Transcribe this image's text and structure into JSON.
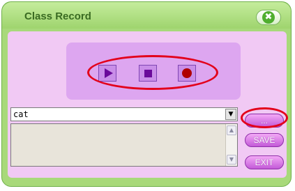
{
  "window": {
    "title": "Class Record",
    "close_icon": "close-icon",
    "close_glyph": "✖"
  },
  "controls": {
    "play_icon": "play-icon",
    "stop_icon": "stop-icon",
    "record_icon": "record-icon"
  },
  "word_select": {
    "selected": "cat",
    "arrow_glyph": "▼"
  },
  "notes": {
    "value": "",
    "scroll_up_glyph": "▲",
    "scroll_down_glyph": "▼"
  },
  "buttons": {
    "more_label": "...",
    "save_label": "SAVE",
    "exit_label": "EXIT"
  },
  "colors": {
    "frame": "#a8d97a",
    "panel": "#f1c9f4",
    "controls_panel": "#dda6f0",
    "button": "#c35ad8",
    "highlight_ring": "#e3001b"
  }
}
